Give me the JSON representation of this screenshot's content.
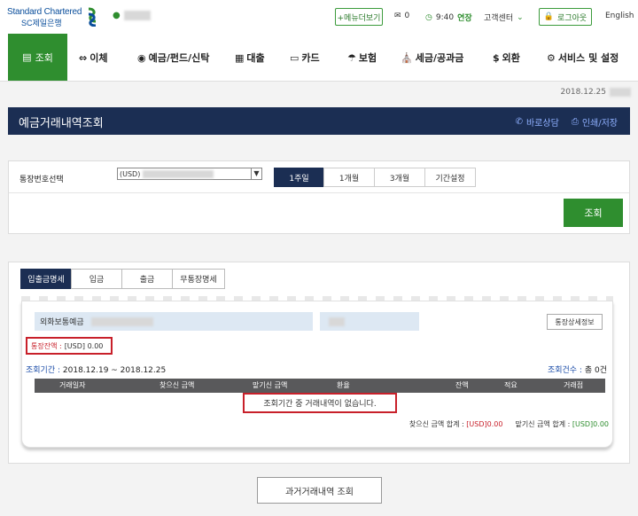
{
  "brand": {
    "line1": "Standard Chartered",
    "line2": "SC제일은행"
  },
  "topbar": {
    "menu_more": "+메뉴더보기",
    "mail_count": "0",
    "timer": "9:40",
    "extend": "연장",
    "customer_center": "고객센터",
    "logout": "로그아웃",
    "language": "English"
  },
  "nav": {
    "active": "조회",
    "items": [
      "이체",
      "예금/펀드/신탁",
      "대출",
      "카드",
      "보험",
      "세금/공과금",
      "외환",
      "서비스 및 설정"
    ]
  },
  "date": "2018.12.25",
  "page_title": "예금거래내역조회",
  "title_links": {
    "consult": "바로상담",
    "print": "인쇄/저장"
  },
  "search": {
    "account_label": "통장번호선택",
    "account_value": "(USD)",
    "period_tabs": [
      "1주일",
      "1개월",
      "3개월",
      "기간설정"
    ],
    "submit": "조회"
  },
  "result": {
    "tabs": [
      "입출금명세",
      "입금",
      "출금",
      "무통장명세"
    ],
    "account_type": "외화보통예금",
    "detail_button": "통장상세정보",
    "balance_label": "통장잔액 :",
    "balance_value": "[USD] 0.00",
    "period_label": "조회기간 :",
    "period_value": "2018.12.19 ~ 2018.12.25",
    "count_label": "조회건수 :",
    "count_value": "총 0건",
    "columns": [
      "거래일자",
      "찾으신 금액",
      "맡기신 금액",
      "환율",
      "잔액",
      "적요",
      "거래점"
    ],
    "empty_message": "조회기간 중 거래내역이 없습니다.",
    "withdraw_total_label": "찾으신 금액 합계 :",
    "withdraw_total_value": "[USD]0.00",
    "deposit_total_label": "맡기신 금액 합계 :",
    "deposit_total_value": "[USD]0.00"
  },
  "past_button": "과거거래내역 조회",
  "colors": {
    "green": "#2f8e2f",
    "navy": "#1b2e53",
    "red": "#c8202a"
  }
}
